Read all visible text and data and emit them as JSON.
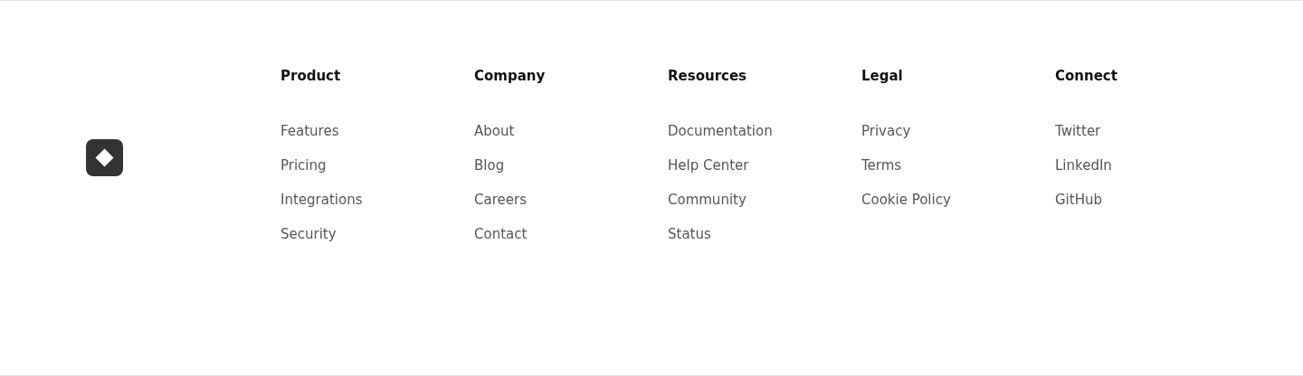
{
  "columns": [
    {
      "heading": "Product",
      "links": [
        "Features",
        "Pricing",
        "Integrations",
        "Security"
      ]
    },
    {
      "heading": "Company",
      "links": [
        "About",
        "Blog",
        "Careers",
        "Contact"
      ]
    },
    {
      "heading": "Resources",
      "links": [
        "Documentation",
        "Help Center",
        "Community",
        "Status"
      ]
    },
    {
      "heading": "Legal",
      "links": [
        "Privacy",
        "Terms",
        "Cookie Policy"
      ]
    },
    {
      "heading": "Connect",
      "links": [
        "Twitter",
        "LinkedIn",
        "GitHub"
      ]
    }
  ]
}
